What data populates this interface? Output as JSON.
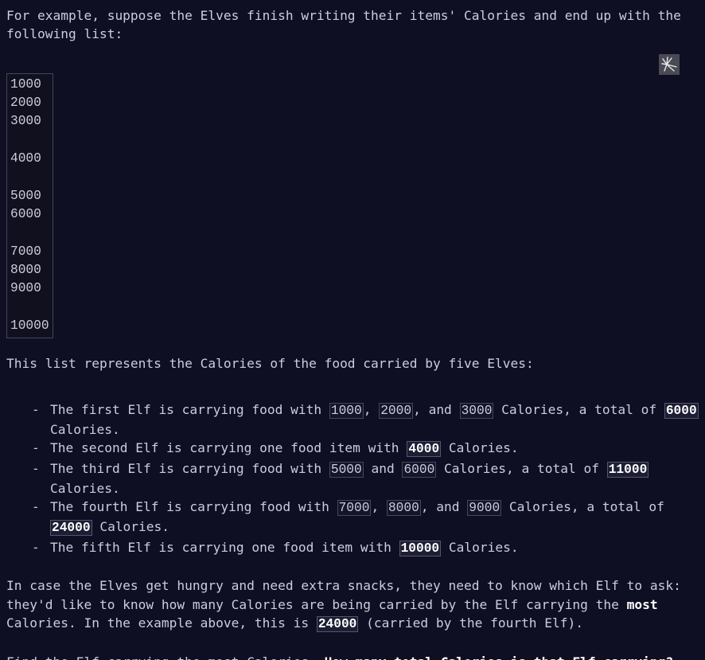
{
  "theme": {
    "background": "#0f0f23",
    "text": "#ccccdd",
    "emphasis": "#ffffff",
    "code_border": "#45455c",
    "code_background": "#10101e"
  },
  "icon": {
    "name": "sparkle-icon",
    "color": "#4a4a55"
  },
  "intro": {
    "text": "For example, suppose the Elves finish writing their items' Calories and end up with the following list:"
  },
  "calorie_list_block": {
    "lines": [
      "1000",
      "2000",
      "3000",
      "",
      "4000",
      "",
      "5000",
      "6000",
      "",
      "7000",
      "8000",
      "9000",
      "",
      "10000"
    ],
    "text": "1000\n2000\n3000\n\n4000\n\n5000\n6000\n\n7000\n8000\n9000\n\n10000"
  },
  "list_intro": {
    "text": "This list represents the Calories of the food carried by five Elves:"
  },
  "elf_items": [
    {
      "dash": "-",
      "parts": [
        {
          "type": "text",
          "value": "The first Elf is carrying food with "
        },
        {
          "type": "code",
          "value": "1000"
        },
        {
          "type": "text",
          "value": ", "
        },
        {
          "type": "code",
          "value": "2000"
        },
        {
          "type": "text",
          "value": ", and "
        },
        {
          "type": "code",
          "value": "3000"
        },
        {
          "type": "text",
          "value": " Calories, a total of "
        },
        {
          "type": "code-em",
          "value": "6000"
        },
        {
          "type": "text",
          "value": " Calories."
        }
      ]
    },
    {
      "dash": "-",
      "parts": [
        {
          "type": "text",
          "value": "The second Elf is carrying one food item with "
        },
        {
          "type": "code-em",
          "value": "4000"
        },
        {
          "type": "text",
          "value": " Calories."
        }
      ]
    },
    {
      "dash": "-",
      "parts": [
        {
          "type": "text",
          "value": "The third Elf is carrying food with "
        },
        {
          "type": "code",
          "value": "5000"
        },
        {
          "type": "text",
          "value": " and "
        },
        {
          "type": "code",
          "value": "6000"
        },
        {
          "type": "text",
          "value": " Calories, a total of "
        },
        {
          "type": "code-em",
          "value": "11000"
        },
        {
          "type": "text",
          "value": " Calories."
        }
      ]
    },
    {
      "dash": "-",
      "parts": [
        {
          "type": "text",
          "value": "The fourth Elf is carrying food with "
        },
        {
          "type": "code",
          "value": "7000"
        },
        {
          "type": "text",
          "value": ", "
        },
        {
          "type": "code",
          "value": "8000"
        },
        {
          "type": "text",
          "value": ", and "
        },
        {
          "type": "code",
          "value": "9000"
        },
        {
          "type": "text",
          "value": " Calories, a total of "
        },
        {
          "type": "code-em",
          "value": "24000"
        },
        {
          "type": "text",
          "value": " Calories."
        }
      ]
    },
    {
      "dash": "-",
      "parts": [
        {
          "type": "text",
          "value": "The fifth Elf is carrying one food item with "
        },
        {
          "type": "code-em",
          "value": "10000"
        },
        {
          "type": "text",
          "value": " Calories."
        }
      ]
    }
  ],
  "hungry_paragraph": {
    "parts": [
      {
        "type": "text",
        "value": "In case the Elves get hungry and need extra snacks, they need to know which Elf to ask: they'd like to know how many Calories are being carried by the Elf carrying the "
      },
      {
        "type": "em",
        "value": "most"
      },
      {
        "type": "text",
        "value": " Calories. In the example above, this is "
      },
      {
        "type": "code-em",
        "value": "24000"
      },
      {
        "type": "text",
        "value": " (carried by the fourth Elf)."
      }
    ]
  },
  "question_paragraph": {
    "parts": [
      {
        "type": "text",
        "value": "Find the Elf carrying the most Calories. "
      },
      {
        "type": "em",
        "value": "How many total Calories is that Elf carrying?"
      }
    ]
  }
}
